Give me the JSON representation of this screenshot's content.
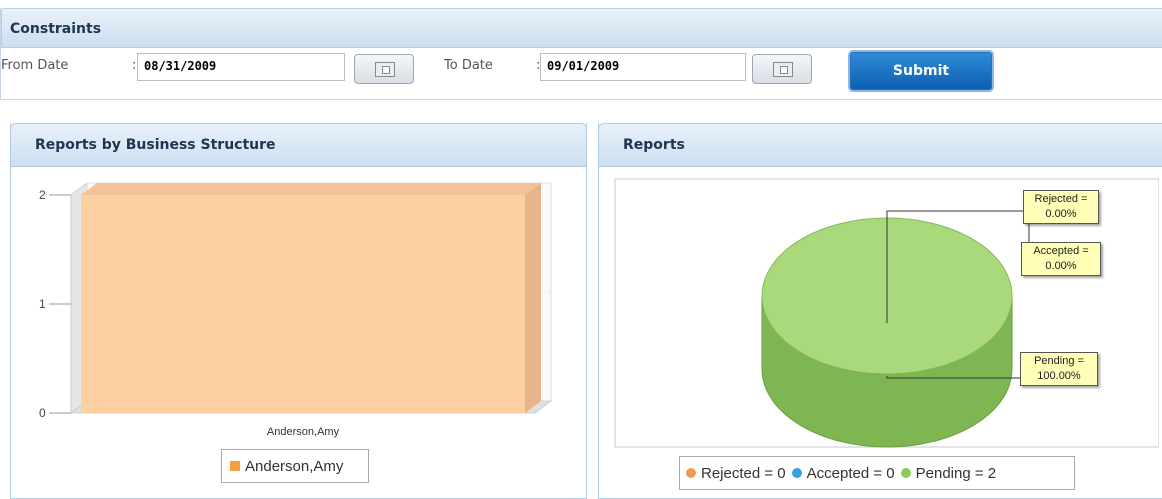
{
  "constraints": {
    "title": "Constraints",
    "from_label": "From Date",
    "from_sep": ":",
    "from_value": "08/31/2009",
    "to_label": "To Date",
    "to_sep": ":",
    "to_value": "09/01/2009",
    "submit_label": "Submit"
  },
  "business_panel": {
    "title": "Reports by Business Structure",
    "legend": "Anderson,Amy",
    "colors": {
      "bar": "#fdd0a2",
      "bar_side": "#e8b48a",
      "swatch": "#f5a040"
    }
  },
  "reports_panel": {
    "title": "Reports",
    "callouts": {
      "rejected": "Rejected =\n0.00%",
      "accepted": "Accepted =\n0.00%",
      "pending": "Pending =\n100.00%"
    },
    "legend": {
      "rejected": "Rejected = 0",
      "accepted": "Accepted = 0",
      "pending": "Pending = 2"
    },
    "colors": {
      "rejected": "#ec9c50",
      "accepted": "#3a9ee2",
      "pending": "#8cc85a"
    }
  },
  "chart_data": [
    {
      "type": "bar",
      "title": "Reports by Business Structure",
      "categories": [
        "Anderson,Amy"
      ],
      "series": [
        {
          "name": "Anderson,Amy",
          "values": [
            2
          ]
        }
      ],
      "yticks": [
        "0",
        "1",
        "2"
      ],
      "ylim": [
        0,
        2
      ]
    },
    {
      "type": "pie",
      "title": "Reports",
      "labels": [
        "Rejected",
        "Accepted",
        "Pending"
      ],
      "values": [
        0,
        0,
        2
      ],
      "percent": [
        "0.00%",
        "0.00%",
        "100.00%"
      ]
    }
  ]
}
